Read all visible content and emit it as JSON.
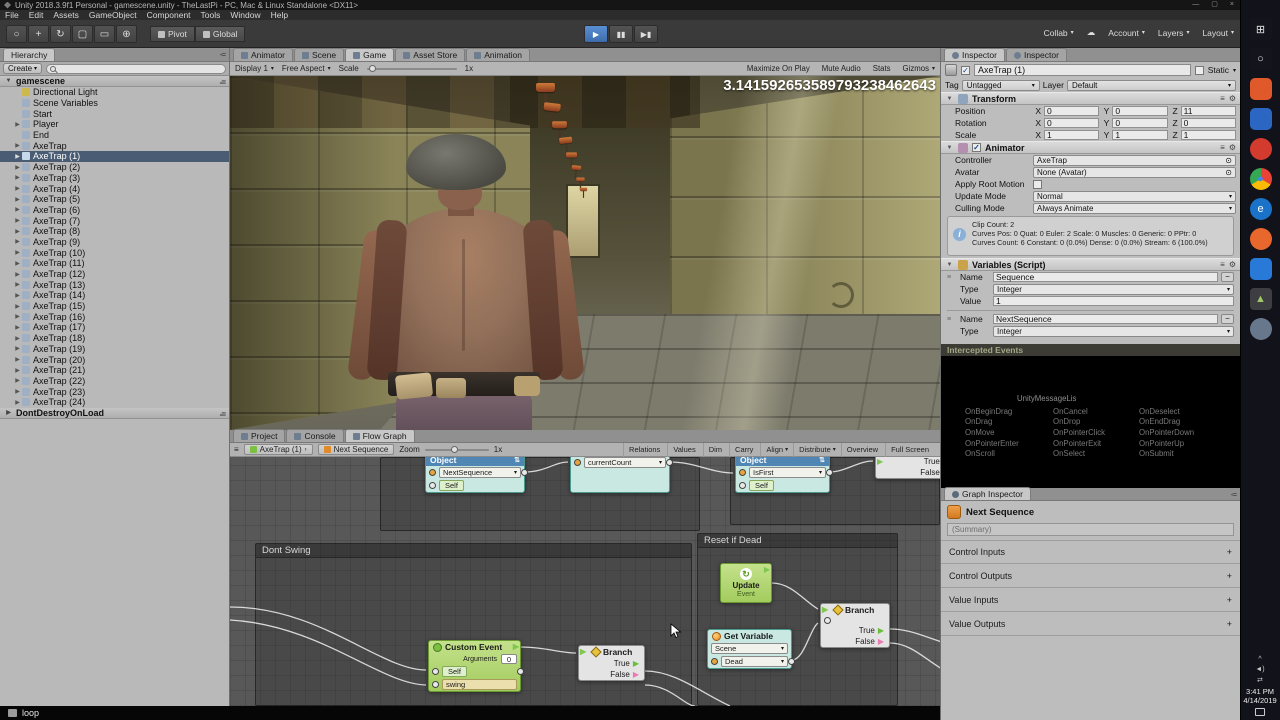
{
  "title_bar": {
    "title": "Unity 2018.3.9f1 Personal - gamescene.unity - TheLastPi - PC, Mac & Linux Standalone <DX11>",
    "minimize": "—",
    "maximize": "▢",
    "close": "×"
  },
  "menu_bar": {
    "items": [
      "File",
      "Edit",
      "Assets",
      "GameObject",
      "Component",
      "Tools",
      "Window",
      "Help"
    ]
  },
  "toolbar": {
    "tools": [
      {
        "glyph": "○"
      },
      {
        "glyph": "+"
      },
      {
        "glyph": "↻"
      },
      {
        "glyph": "▢"
      },
      {
        "glyph": "▭"
      },
      {
        "glyph": "⊕"
      }
    ],
    "pivot": "Pivot",
    "global": "Global",
    "play": "▶",
    "pause": "▮▮",
    "step": "▶▮",
    "collab": "Collab",
    "cloud": "☁",
    "account": "Account",
    "layers": "Layers",
    "layout": "Layout"
  },
  "icons": {
    "dd": "▾",
    "open": "▼",
    "closed": "▶",
    "menu": "-=",
    "check": "✓",
    "gear": "⚙",
    "lines": "≡",
    "target": "⊙",
    "minus": "−",
    "info": "i",
    "sep": "›"
  },
  "hierarchy": {
    "tab": "Hierarchy",
    "create": "Create",
    "scene": "gamescene",
    "items": [
      {
        "label": "Directional Light",
        "tri": "",
        "ic": "#cdb84d"
      },
      {
        "label": "Scene Variables",
        "tri": "",
        "ic": "#9fb0c4"
      },
      {
        "label": "Start",
        "tri": "",
        "ic": "#9fb0c4"
      },
      {
        "label": "Player",
        "tri": "▶",
        "ic": "#9fb0c4"
      },
      {
        "label": "End",
        "tri": "",
        "ic": "#9fb0c4"
      },
      {
        "label": "AxeTrap",
        "tri": "▶",
        "ic": "#9fb0c4"
      },
      {
        "label": "AxeTrap (1)",
        "tri": "▶",
        "ic": "#c6d8ea",
        "cls": "selected"
      },
      {
        "label": "AxeTrap (2)",
        "tri": "▶",
        "ic": "#9fb0c4"
      },
      {
        "label": "AxeTrap (3)",
        "tri": "▶",
        "ic": "#9fb0c4"
      },
      {
        "label": "AxeTrap (4)",
        "tri": "▶",
        "ic": "#9fb0c4"
      },
      {
        "label": "AxeTrap (5)",
        "tri": "▶",
        "ic": "#9fb0c4"
      },
      {
        "label": "AxeTrap (6)",
        "tri": "▶",
        "ic": "#9fb0c4"
      },
      {
        "label": "AxeTrap (7)",
        "tri": "▶",
        "ic": "#9fb0c4"
      },
      {
        "label": "AxeTrap (8)",
        "tri": "▶",
        "ic": "#9fb0c4"
      },
      {
        "label": "AxeTrap (9)",
        "tri": "▶",
        "ic": "#9fb0c4"
      },
      {
        "label": "AxeTrap (10)",
        "tri": "▶",
        "ic": "#9fb0c4"
      },
      {
        "label": "AxeTrap (11)",
        "tri": "▶",
        "ic": "#9fb0c4"
      },
      {
        "label": "AxeTrap (12)",
        "tri": "▶",
        "ic": "#9fb0c4"
      },
      {
        "label": "AxeTrap (13)",
        "tri": "▶",
        "ic": "#9fb0c4"
      },
      {
        "label": "AxeTrap (14)",
        "tri": "▶",
        "ic": "#9fb0c4"
      },
      {
        "label": "AxeTrap (15)",
        "tri": "▶",
        "ic": "#9fb0c4"
      },
      {
        "label": "AxeTrap (16)",
        "tri": "▶",
        "ic": "#9fb0c4"
      },
      {
        "label": "AxeTrap (17)",
        "tri": "▶",
        "ic": "#9fb0c4"
      },
      {
        "label": "AxeTrap (18)",
        "tri": "▶",
        "ic": "#9fb0c4"
      },
      {
        "label": "AxeTrap (19)",
        "tri": "▶",
        "ic": "#9fb0c4"
      },
      {
        "label": "AxeTrap (20)",
        "tri": "▶",
        "ic": "#9fb0c4"
      },
      {
        "label": "AxeTrap (21)",
        "tri": "▶",
        "ic": "#9fb0c4"
      },
      {
        "label": "AxeTrap (22)",
        "tri": "▶",
        "ic": "#9fb0c4"
      },
      {
        "label": "AxeTrap (23)",
        "tri": "▶",
        "ic": "#9fb0c4"
      },
      {
        "label": "AxeTrap (24)",
        "tri": "▶",
        "ic": "#9fb0c4"
      }
    ],
    "bottom_scene": "DontDestroyOnLoad"
  },
  "game_view": {
    "tabs": [
      {
        "label": "Animator"
      },
      {
        "label": "Scene"
      },
      {
        "label": "Game",
        "cls": "active"
      },
      {
        "label": "Asset Store"
      },
      {
        "label": "Animation"
      }
    ],
    "display": "Display 1",
    "aspect": "Free Aspect",
    "scale_label": "Scale",
    "scale_value": "1x",
    "buttons": [
      {
        "label": "Maximize On Play"
      },
      {
        "label": "Mute Audio"
      },
      {
        "label": "Stats"
      },
      {
        "label": "Gizmos",
        "arrow": "▾"
      }
    ],
    "overlay_number": "3.141592653589793238462643"
  },
  "flow": {
    "tabs": [
      {
        "label": "Project"
      },
      {
        "label": "Console"
      },
      {
        "label": "Flow Graph",
        "cls": "active"
      }
    ],
    "crumb_object": "AxeTrap (1)",
    "crumb_graph": "Next Sequence",
    "zoom_label": "Zoom",
    "zoom_value": "1x",
    "buttons": [
      {
        "label": "Relations"
      },
      {
        "label": "Values"
      },
      {
        "label": "Dim"
      },
      {
        "label": "Carry"
      },
      {
        "label": "Align",
        "arrow": "▾"
      },
      {
        "label": "Distribute",
        "arrow": "▾"
      },
      {
        "label": "Overview"
      },
      {
        "label": "Full Screen"
      }
    ],
    "groups": {
      "dont_swing": "Dont Swing",
      "reset_if_dead": "Reset if Dead"
    },
    "nodes": {
      "object_a": {
        "title": "Object",
        "field1": "NextSequence",
        "field2": "Self"
      },
      "current_count": {
        "title": "currentCount"
      },
      "object_b": {
        "title": "Object",
        "field1": "IsFirst",
        "field2": "Self"
      },
      "branch_top": {
        "true_label": "True",
        "false_label": "False"
      },
      "update_event": {
        "title": "Update",
        "subtitle": "Event"
      },
      "branch_right": {
        "title": "Branch",
        "true_label": "True",
        "false_label": "False"
      },
      "get_variable": {
        "title": "Get Variable",
        "scope": "Scene",
        "field": "Dead"
      },
      "custom_event": {
        "title": "Custom Event",
        "args_label": "Arguments",
        "args_value": "0",
        "field1": "Self",
        "field2": "swing"
      },
      "branch_left": {
        "title": "Branch",
        "true_label": "True",
        "false_label": "False"
      }
    }
  },
  "inspector": {
    "tabs": [
      {
        "label": "Inspector",
        "cls": "active"
      },
      {
        "label": "Inspector"
      }
    ],
    "header": {
      "name": "AxeTrap (1)",
      "static_label": "Static"
    },
    "tag_row": {
      "tag_label": "Tag",
      "tag_value": "Untagged",
      "layer_label": "Layer",
      "layer_value": "Default"
    },
    "transform": {
      "title": "Transform",
      "rows": [
        {
          "label": "Position",
          "xl": "X",
          "x": "0",
          "yl": "Y",
          "y": "0",
          "zl": "Z",
          "z": "11"
        },
        {
          "label": "Rotation",
          "xl": "X",
          "x": "0",
          "yl": "Y",
          "y": "0",
          "zl": "Z",
          "z": "0"
        },
        {
          "label": "Scale",
          "xl": "X",
          "x": "1",
          "yl": "Y",
          "y": "1",
          "zl": "Z",
          "z": "1"
        }
      ]
    },
    "animator": {
      "title": "Animator",
      "controller_label": "Controller",
      "controller_value": "AxeTrap",
      "avatar_label": "Avatar",
      "avatar_value": "None (Avatar)",
      "root_motion_label": "Apply Root Motion",
      "update_mode_label": "Update Mode",
      "update_mode_value": "Normal",
      "culling_label": "Culling Mode",
      "culling_value": "Always Animate",
      "info_lines": [
        "Clip Count: 2",
        "Curves Pos: 0 Quat: 0 Euler: 2 Scale: 0 Muscles: 0 Generic: 0 PPtr: 0",
        "Curves Count: 6 Constant: 0 (0.0%) Dense: 0 (0.0%) Stream: 6 (100.0%)"
      ]
    },
    "variables": {
      "title": "Variables (Script)",
      "name_label": "Name",
      "type_label": "Type",
      "value_label": "Value",
      "entry1": {
        "name": "Sequence",
        "type": "Integer",
        "value": "1"
      },
      "entry2": {
        "name": "NextSequence",
        "type": "Integer"
      }
    },
    "intercepted": {
      "title": "Intercepted Events",
      "listener": "UnityMessageLis",
      "rows": [
        [
          "OnBeginDrag",
          "OnCancel",
          "OnDeselect"
        ],
        [
          "OnDrag",
          "OnDrop",
          "OnEndDrag"
        ],
        [
          "OnMove",
          "OnPointerClick",
          "OnPointerDown"
        ],
        [
          "OnPointerEnter",
          "OnPointerExit",
          "OnPointerUp"
        ],
        [
          "OnScroll",
          "OnSelect",
          "OnSubmit"
        ]
      ]
    }
  },
  "graph_inspector": {
    "tab": "Graph Inspector",
    "node_title": "Next Sequence",
    "summary": "(Summary)",
    "sections": [
      {
        "label": "Control Inputs",
        "plus": "+"
      },
      {
        "label": "Control Outputs",
        "plus": "+"
      },
      {
        "label": "Value Inputs",
        "plus": "+"
      },
      {
        "label": "Value Outputs",
        "plus": "+"
      }
    ]
  },
  "taskbar": {
    "apps": [
      {
        "glyph": "⊞",
        "bg": "#14141c",
        "fg": "#e6e6e6",
        "rad": "3px"
      },
      {
        "glyph": "○",
        "bg": "#14141c",
        "fg": "#e6e6e6",
        "rad": "3px"
      },
      {
        "glyph": "",
        "bg": "#e0592b",
        "fg": "#ffffff",
        "rad": "5px"
      },
      {
        "glyph": "",
        "bg": "#2a66c2",
        "fg": "#ffffff",
        "rad": "5px"
      },
      {
        "glyph": "",
        "bg": "#d23b2e",
        "fg": "#ffffff",
        "rad": "50%"
      },
      {
        "glyph": "●",
        "bg": "conic-gradient(#e84335 0deg 120deg,#f9bb05 120deg 240deg,#35a853 240deg 360deg)",
        "fg": "#4285f4",
        "rad": "50%"
      },
      {
        "glyph": "e",
        "bg": "#1a73c8",
        "fg": "#ffffff",
        "rad": "50%"
      },
      {
        "glyph": "",
        "bg": "#e8672c",
        "fg": "#ffffff",
        "rad": "50%"
      },
      {
        "glyph": "",
        "bg": "#2979d8",
        "fg": "#ffffff",
        "rad": "5px"
      },
      {
        "glyph": "▲",
        "bg": "#3d3d42",
        "fg": "#9ec86a",
        "rad": "4px"
      },
      {
        "glyph": "",
        "bg": "#68788c",
        "fg": "#ffffff",
        "rad": "50%"
      }
    ],
    "tray": [
      {
        "glyph": "^"
      },
      {
        "glyph": "◄)"
      },
      {
        "glyph": "⇄"
      }
    ],
    "clock_time": "3:41 PM",
    "clock_date": "4/14/2019"
  },
  "status": {
    "label": "loop"
  }
}
